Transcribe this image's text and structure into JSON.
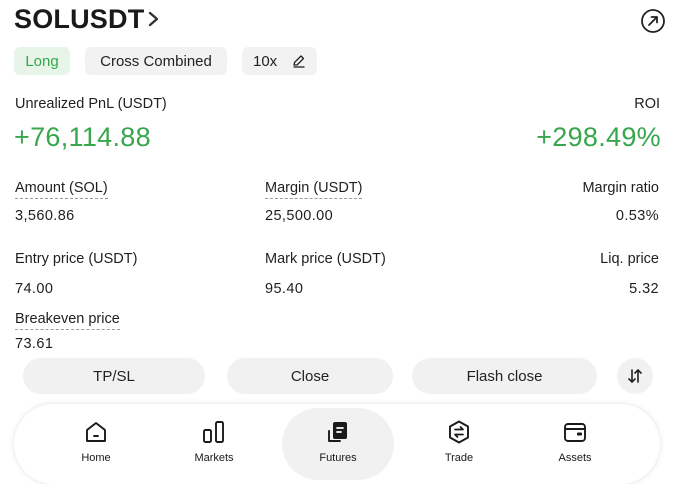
{
  "header": {
    "symbol": "SOLUSDT"
  },
  "tags": {
    "side": "Long",
    "margin_mode": "Cross Combined",
    "leverage": "10x"
  },
  "pnl": {
    "unrealized_label": "Unrealized PnL (USDT)",
    "unrealized_value": "+76,114.88",
    "roi_label": "ROI",
    "roi_value": "+298.49%"
  },
  "stats": {
    "amount_label": "Amount (SOL)",
    "amount_value": "3,560.86",
    "margin_label": "Margin (USDT)",
    "margin_value": "25,500.00",
    "margin_ratio_label": "Margin ratio",
    "margin_ratio_value": "0.53%",
    "entry_label": "Entry price (USDT)",
    "entry_value": "74.00",
    "mark_label": "Mark price (USDT)",
    "mark_value": "95.40",
    "liq_label": "Liq. price",
    "liq_value": "5.32",
    "breakeven_label": "Breakeven price",
    "breakeven_value": "73.61"
  },
  "actions": {
    "tpsl": "TP/SL",
    "close": "Close",
    "flash_close": "Flash close"
  },
  "nav": {
    "items": [
      {
        "label": "Home",
        "icon": "home-icon"
      },
      {
        "label": "Markets",
        "icon": "markets-icon"
      },
      {
        "label": "Futures",
        "icon": "futures-icon"
      },
      {
        "label": "Trade",
        "icon": "trade-icon"
      },
      {
        "label": "Assets",
        "icon": "assets-icon"
      }
    ],
    "active": "Futures"
  },
  "colors": {
    "positive": "#38a64d",
    "long_bg": "#e7f4e8",
    "pill_bg": "#f2f2f2",
    "button_bg": "#f1f1f1"
  }
}
